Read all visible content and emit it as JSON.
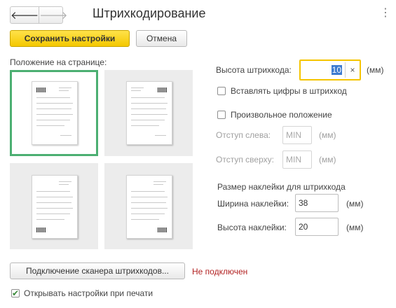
{
  "header": {
    "title": "Штрихкодирование",
    "back_glyph": "🡐",
    "forward_glyph": "🡒",
    "more_glyph": "⋮"
  },
  "toolbar": {
    "save_label": "Сохранить настройки",
    "cancel_label": "Отмена"
  },
  "position": {
    "label": "Положение на странице:",
    "selected": "top-left",
    "tiles": [
      "top-left",
      "top-right",
      "bottom-left",
      "bottom-right"
    ]
  },
  "barcode_height": {
    "label": "Высота штрихкода:",
    "value": "10",
    "unit": "(мм)",
    "clear_glyph": "×"
  },
  "insert_digits": {
    "label": "Вставлять цифры в штрихкод",
    "checked": false
  },
  "arbitrary_position": {
    "label": "Произвольное положение",
    "checked": false
  },
  "offset_left": {
    "label": "Отступ слева:",
    "value": "MIN",
    "unit": "(мм)"
  },
  "offset_top": {
    "label": "Отступ сверху:",
    "value": "MIN",
    "unit": "(мм)"
  },
  "sticker": {
    "section_label": "Размер наклейки для штрихкода",
    "width_label": "Ширина наклейки:",
    "width_value": "38",
    "height_label": "Высота наклейки:",
    "height_value": "20",
    "unit": "(мм)"
  },
  "scanner": {
    "button_label": "Подключение сканера штрихкодов...",
    "status": "Не подключен"
  },
  "open_settings": {
    "label": "Открывать настройки при печати",
    "checked": true,
    "check_glyph": "✔"
  },
  "colors": {
    "accent": "#f4c800",
    "selected_border": "#4caf72",
    "status_red": "#b22222"
  }
}
